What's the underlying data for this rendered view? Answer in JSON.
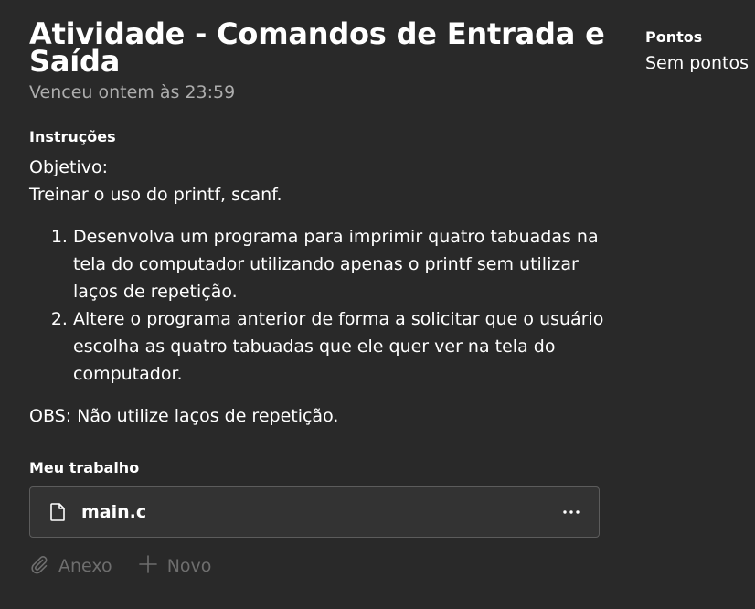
{
  "assignment": {
    "title": "Atividade - Comandos de Entrada e Saída",
    "due": "Venceu ontem às 23:59"
  },
  "instructions": {
    "label": "Instruções",
    "objective_label": "Objetivo:",
    "objective_text": "Treinar o uso do printf, scanf.",
    "items": [
      "Desenvolva um programa para imprimir quatro tabuadas na tela do computador utilizando apenas o printf sem utilizar laços de repetição.",
      "Altere o programa anterior de forma a solicitar que o usuário escolha as quatro tabuadas que ele quer ver na tela do computador."
    ],
    "note": "OBS: Não utilize laços de repetição."
  },
  "my_work": {
    "label": "Meu trabalho",
    "file": {
      "name": "main.c",
      "icon": "file-icon",
      "more_icon": "more-options-icon"
    },
    "actions": [
      {
        "label": "Anexo",
        "icon": "paperclip-icon"
      },
      {
        "label": "Novo",
        "icon": "plus-icon"
      }
    ]
  },
  "points": {
    "label": "Pontos",
    "value": "Sem pontos"
  },
  "colors": {
    "background": "#292929",
    "text": "#ffffff",
    "muted_text": "#adadad",
    "disabled_text": "#6e6e6e",
    "card_border": "#5c5c5c"
  }
}
